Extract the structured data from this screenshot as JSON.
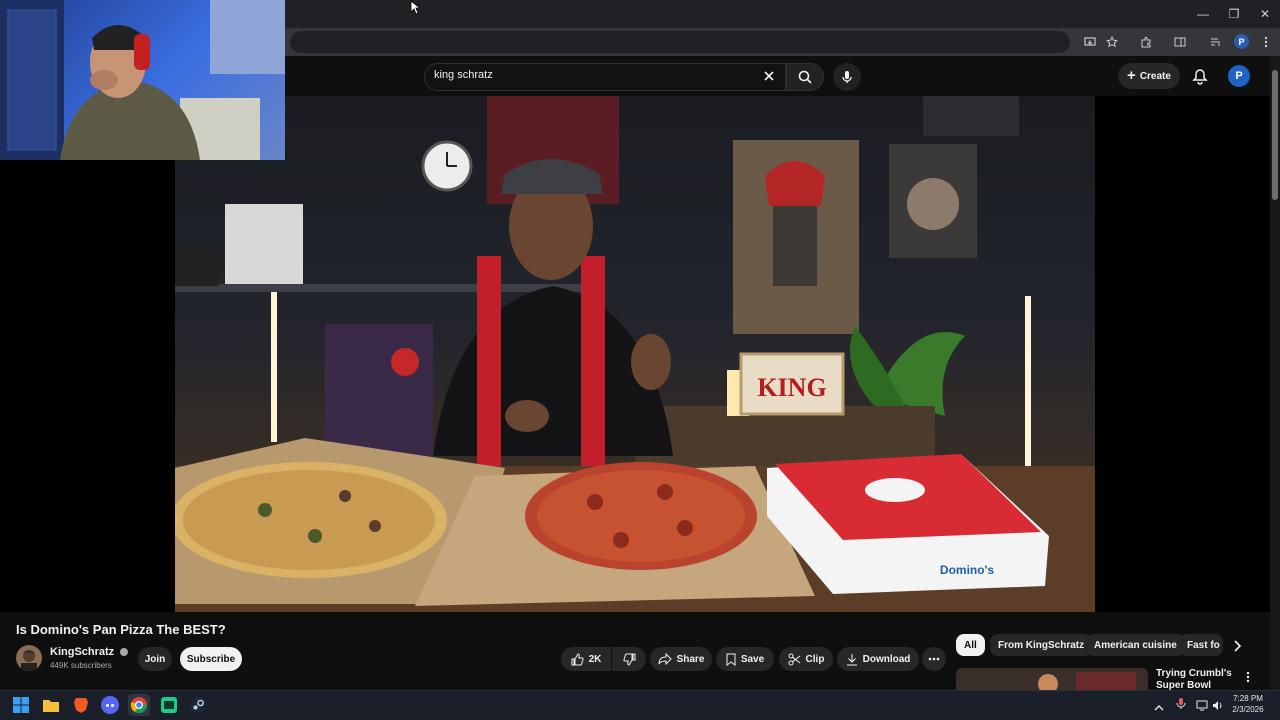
{
  "browser": {
    "window_controls": {
      "minimize": "—",
      "restore": "❐",
      "close": "✕"
    }
  },
  "header": {
    "search_value": "king schratz",
    "create_label": "Create",
    "avatar_letter": "P"
  },
  "video": {
    "sign_text": "KING",
    "box_brand": "Domino's"
  },
  "watch": {
    "title": "Is Domino's Pan Pizza The BEST?",
    "channel_name": "KingSchratz",
    "subscribers": "449K subscribers",
    "join_label": "Join",
    "subscribe_label": "Subscribe",
    "like_count": "2K",
    "share_label": "Share",
    "save_label": "Save",
    "clip_label": "Clip",
    "download_label": "Download"
  },
  "chips": [
    "All",
    "From KingSchratz",
    "American cuisine",
    "Fast fo"
  ],
  "recommendation": {
    "title": "Trying Crumbl's Super Bowl Lineup"
  },
  "taskbar": {
    "time": "7:28 PM",
    "date": "2/3/2026"
  },
  "colors": {
    "accent_blue": "#1f63c4",
    "youtube_bg": "#0f0f0f",
    "box_red": "#d92b33"
  }
}
